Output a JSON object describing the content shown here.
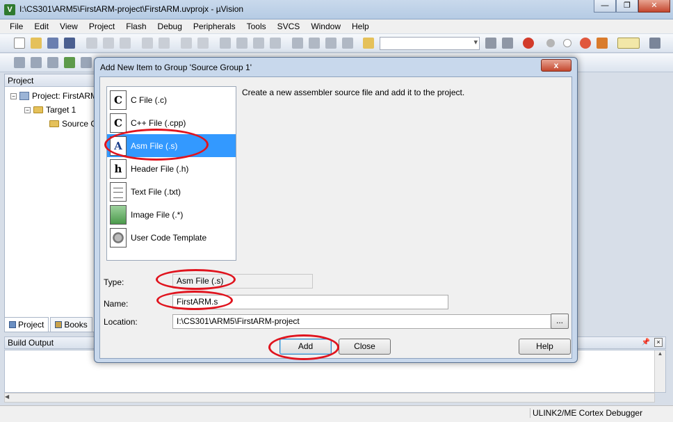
{
  "window": {
    "title": "I:\\CS301\\ARM5\\FirstARM-project\\FirstARM.uvprojx - µVision",
    "app_icon": "V"
  },
  "menu": [
    "File",
    "Edit",
    "View",
    "Project",
    "Flash",
    "Debug",
    "Peripherals",
    "Tools",
    "SVCS",
    "Window",
    "Help"
  ],
  "project_pane": {
    "header": "Project",
    "tree": {
      "project": "Project: FirstARM",
      "target": "Target 1",
      "group": "Source G"
    },
    "tabs": [
      "Project",
      "Books"
    ]
  },
  "build_output": {
    "header": "Build Output"
  },
  "status_bar": {
    "debugger": "ULINK2/ME Cortex Debugger"
  },
  "dialog": {
    "title": "Add New Item to Group 'Source Group 1'",
    "close_glyph": "x",
    "items": [
      {
        "label": "C File (.c)",
        "icon": "c-file-icon",
        "glyph": "C"
      },
      {
        "label": "C++ File (.cpp)",
        "icon": "cpp-file-icon",
        "glyph": "C"
      },
      {
        "label": "Asm File (.s)",
        "icon": "asm-file-icon",
        "glyph": "A",
        "selected": true
      },
      {
        "label": "Header File (.h)",
        "icon": "header-file-icon",
        "glyph": "h"
      },
      {
        "label": "Text File (.txt)",
        "icon": "text-file-icon",
        "glyph": ""
      },
      {
        "label": "Image File (.*)",
        "icon": "image-file-icon",
        "glyph": ""
      },
      {
        "label": "User Code Template",
        "icon": "template-icon",
        "glyph": ""
      }
    ],
    "description": "Create a new assembler source file and add it to the project.",
    "type_label": "Type:",
    "type_value": "Asm File (.s)",
    "name_label": "Name:",
    "name_value": "FirstARM.s",
    "location_label": "Location:",
    "location_value": "I:\\CS301\\ARM5\\FirstARM-project",
    "browse_label": "...",
    "buttons": {
      "add": "Add",
      "close": "Close",
      "help": "Help"
    }
  },
  "colors": {
    "selection": "#3399ff",
    "annotation": "#e0141e",
    "dialog_frame": "#c8d8ec"
  }
}
